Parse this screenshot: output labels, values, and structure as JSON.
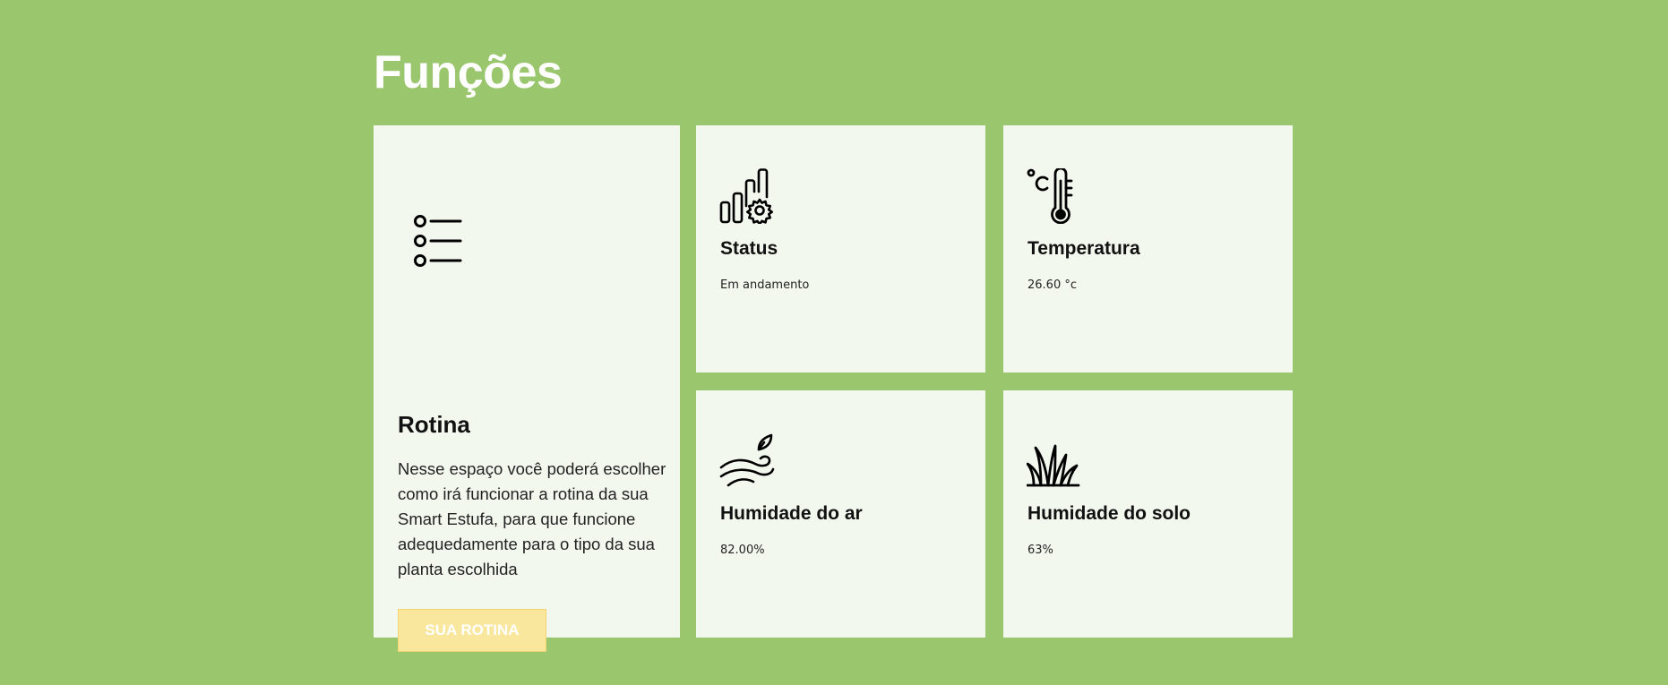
{
  "page": {
    "title": "Funções",
    "background_color": "#9ac66d",
    "card_color": "#f3f8ef"
  },
  "rotina": {
    "icon": "list-icon",
    "title": "Rotina",
    "description": "Nesse espaço você poderá escolher como irá funcionar a rotina da sua Smart Estufa, para que funcione adequedamente para o tipo da sua planta escolhida",
    "button_label": "SUA ROTINA",
    "button_color": "#f9e79d"
  },
  "status": {
    "icon": "chart-gear-icon",
    "title": "Status",
    "value": "Em andamento"
  },
  "temperatura": {
    "icon": "thermometer-icon",
    "title": "Temperatura",
    "value": "26.60 °c"
  },
  "humidade_ar": {
    "icon": "wind-leaf-icon",
    "title": "Humidade do ar",
    "value": "82.00%"
  },
  "humidade_solo": {
    "icon": "grass-icon",
    "title": "Humidade do solo",
    "value": "63%"
  }
}
